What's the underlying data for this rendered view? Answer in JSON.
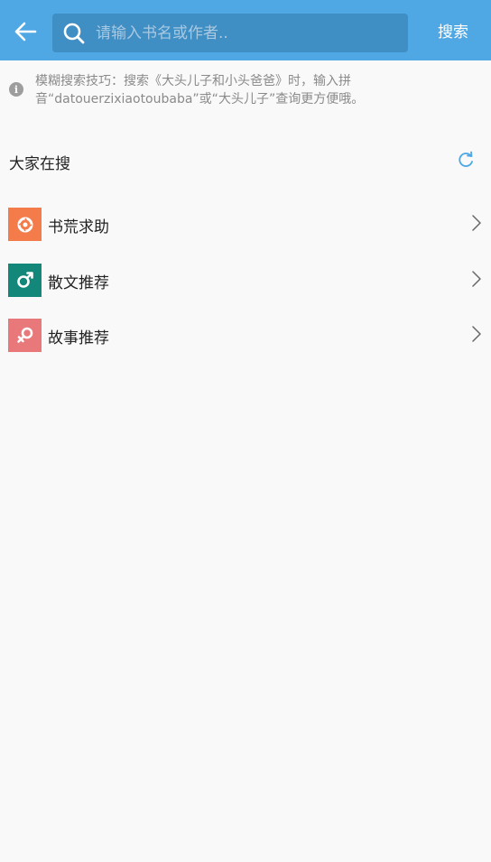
{
  "header": {
    "back_icon": "arrow-left-icon",
    "search_icon": "search-icon",
    "search_placeholder": "请输入书名或作者..",
    "search_value": "",
    "search_button": "搜索",
    "accent_color": "#4fa8e4"
  },
  "tip": {
    "icon": "info-icon",
    "text": "模糊搜索技巧：搜索《大头儿子和小头爸爸》时，输入拼音“datouerzixiaotoubaba”或“大头儿子”查询更方便哦。"
  },
  "trending": {
    "title": "大家在搜",
    "refresh_icon": "refresh-icon"
  },
  "categories": [
    {
      "label": "书荒求助",
      "icon": "aperture-icon",
      "color": "#f47c4a"
    },
    {
      "label": "散文推荐",
      "icon": "male-symbol-icon",
      "color": "#13877a"
    },
    {
      "label": "故事推荐",
      "icon": "female-symbol-icon",
      "color": "#e8787a"
    }
  ]
}
